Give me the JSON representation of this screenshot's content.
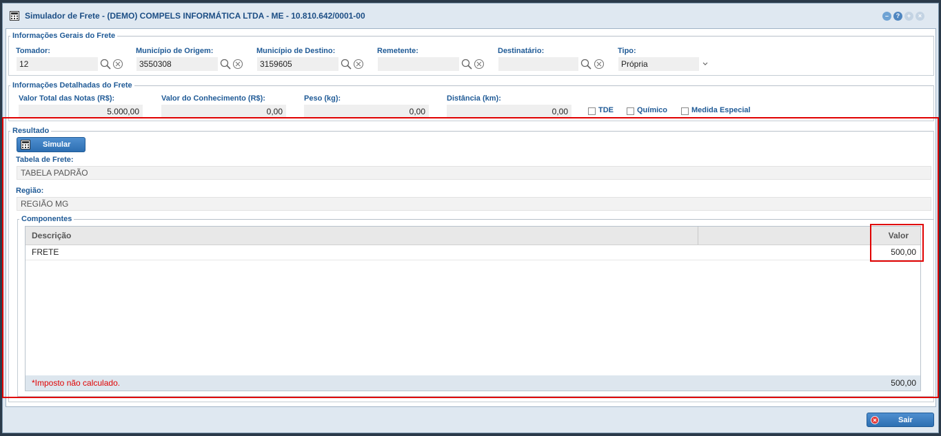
{
  "window": {
    "title": "Simulador de Frete - (DEMO) COMPELS INFORMÁTICA LTDA - ME - 10.810.642/0001-00"
  },
  "geral": {
    "legend": "Informações Gerais do Frete",
    "tomador": {
      "label": "Tomador:",
      "value": "12"
    },
    "origem": {
      "label": "Município de Origem:",
      "value": "3550308"
    },
    "destino": {
      "label": "Município de Destino:",
      "value": "3159605"
    },
    "remetente": {
      "label": "Remetente:",
      "value": ""
    },
    "destinatario": {
      "label": "Destinatário:",
      "value": ""
    },
    "tipo": {
      "label": "Tipo:",
      "value": "Própria"
    }
  },
  "detalhe": {
    "legend": "Informações Detalhadas do Frete",
    "valor_notas": {
      "label": "Valor Total das Notas (R$):",
      "value": "5.000,00"
    },
    "valor_conhecimento": {
      "label": "Valor do Conhecimento (R$):",
      "value": "0,00"
    },
    "peso": {
      "label": "Peso (kg):",
      "value": "0,00"
    },
    "distancia": {
      "label": "Distância (km):",
      "value": "0,00"
    },
    "tde": "TDE",
    "quimico": "Químico",
    "medida": "Medida Especial"
  },
  "resultado": {
    "legend": "Resultado",
    "simular": "Simular",
    "tabela_label": "Tabela de Frete:",
    "tabela_value": "TABELA PADRÃO",
    "regiao_label": "Região:",
    "regiao_value": "REGIÃO MG",
    "componentes_legend": "Componentes",
    "grid": {
      "col_descricao": "Descrição",
      "col_valor": "Valor",
      "rows": [
        {
          "descricao": "FRETE",
          "valor": "500,00"
        }
      ],
      "footer_note": "*Imposto não calculado.",
      "footer_total": "500,00"
    }
  },
  "footer": {
    "sair": "Sair"
  },
  "colors": {
    "accent": "#1f5a96",
    "highlight": "#e00000",
    "warning": "#e00000"
  }
}
